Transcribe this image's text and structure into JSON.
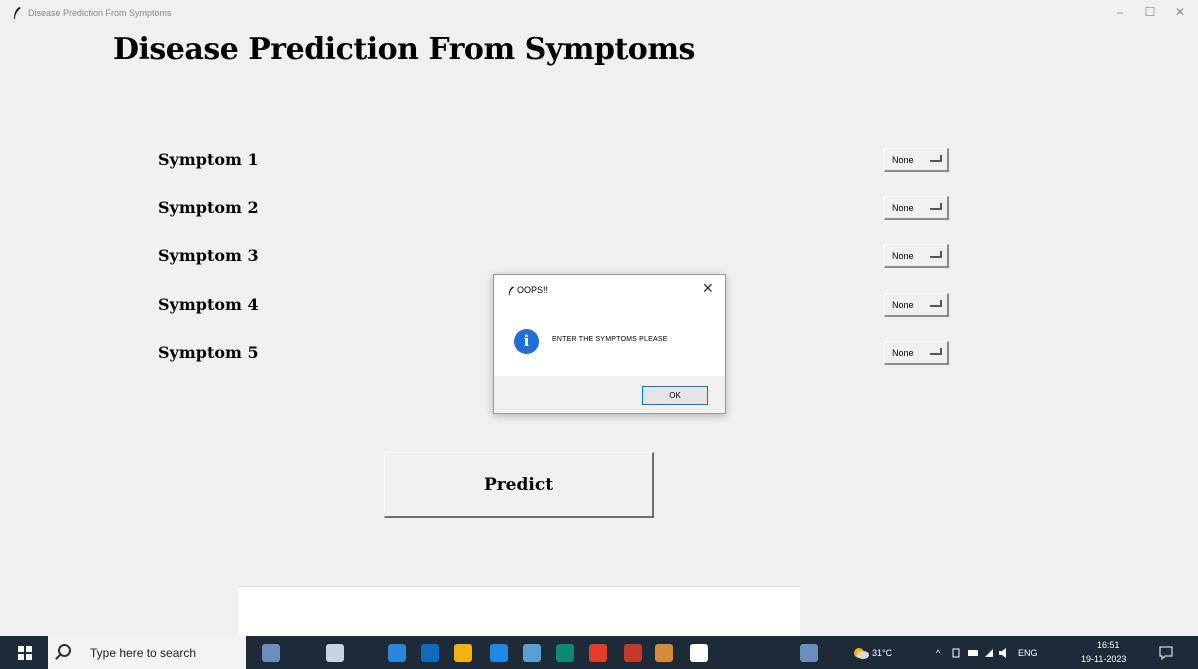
{
  "window": {
    "title": "Disease Prediction From Symptoms",
    "controls": {
      "minimize": "–",
      "maximize": "☐",
      "close": "✕"
    }
  },
  "app": {
    "heading": "Disease Prediction From Symptoms",
    "symptoms": [
      {
        "label": "Symptom 1",
        "value": "None"
      },
      {
        "label": "Symptom 2",
        "value": "None"
      },
      {
        "label": "Symptom 3",
        "value": "None"
      },
      {
        "label": "Symptom 4",
        "value": "None"
      },
      {
        "label": "Symptom 5",
        "value": "None"
      }
    ],
    "predict_label": "Predict",
    "result_text": ""
  },
  "dialog": {
    "title": "OOPS!!",
    "close": "✕",
    "icon": "info-icon",
    "icon_glyph": "i",
    "message": "ENTER THE SYMPTOMS PLEASE",
    "ok_label": "OK"
  },
  "taskbar": {
    "search_placeholder": "Type here to search",
    "weather": "31°C",
    "language": "ENG",
    "time": "16:51",
    "date": "19-11-2023",
    "up_arrow": "^",
    "colors": {
      "background": "#1d2a38",
      "icons": [
        "#6c8ebf",
        "#c9d3e0",
        "#2b88d8",
        "#0f6cbd",
        "#f2b311",
        "#1e88e5",
        "#5a9fd4",
        "#0a8a6e",
        "#e23c2a",
        "#c0392b",
        "#d38a3b",
        "#ffffff"
      ]
    }
  }
}
